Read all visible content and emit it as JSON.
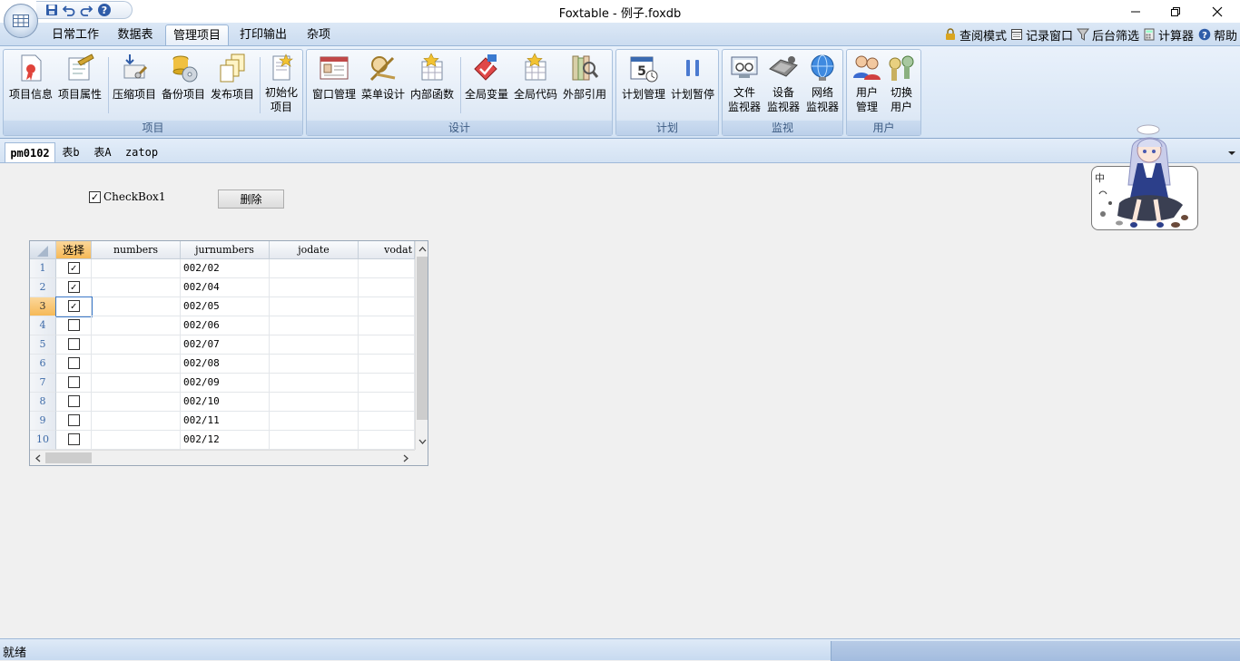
{
  "window": {
    "title": "Foxtable - 例子.foxdb"
  },
  "ribbon_tabs": [
    {
      "label": "日常工作",
      "active": false
    },
    {
      "label": "数据表",
      "active": false
    },
    {
      "label": "管理项目",
      "active": true
    },
    {
      "label": "打印输出",
      "active": false
    },
    {
      "label": "杂项",
      "active": false
    }
  ],
  "right_tools": [
    {
      "label": "查阅模式",
      "icon": "lock-icon"
    },
    {
      "label": "记录窗口",
      "icon": "window-icon"
    },
    {
      "label": "后台筛选",
      "icon": "filter-icon"
    },
    {
      "label": "计算器",
      "icon": "calculator-icon"
    },
    {
      "label": "帮助",
      "icon": "help-icon"
    }
  ],
  "groups": [
    {
      "label": "项目",
      "buttons": [
        {
          "label": "项目信息",
          "icon": "project-info-icon"
        },
        {
          "label": "项目属性",
          "icon": "project-properties-icon"
        },
        {
          "label": "压缩项目",
          "icon": "compress-project-icon"
        },
        {
          "label": "备份项目",
          "icon": "backup-project-icon"
        },
        {
          "label": "发布项目",
          "icon": "publish-project-icon"
        },
        {
          "label": "初始化\n项目",
          "icon": "initialize-project-icon"
        }
      ]
    },
    {
      "label": "设计",
      "buttons": [
        {
          "label": "窗口管理",
          "icon": "window-manage-icon"
        },
        {
          "label": "菜单设计",
          "icon": "menu-design-icon"
        },
        {
          "label": "内部函数",
          "icon": "internal-function-icon"
        },
        {
          "label": "全局变量",
          "icon": "global-variable-icon"
        },
        {
          "label": "全局代码",
          "icon": "global-code-icon"
        },
        {
          "label": "外部引用",
          "icon": "external-reference-icon"
        }
      ]
    },
    {
      "label": "计划",
      "buttons": [
        {
          "label": "计划管理",
          "icon": "schedule-manage-icon"
        },
        {
          "label": "计划暂停",
          "icon": "pause-icon"
        }
      ]
    },
    {
      "label": "监视",
      "buttons": [
        {
          "label": "文件\n监视器",
          "icon": "file-monitor-icon"
        },
        {
          "label": "设备\n监视器",
          "icon": "device-monitor-icon"
        },
        {
          "label": "网络\n监视器",
          "icon": "network-monitor-icon"
        }
      ]
    },
    {
      "label": "用户",
      "buttons": [
        {
          "label": "用户\n管理",
          "icon": "user-manage-icon"
        },
        {
          "label": "切换\n用户",
          "icon": "switch-user-icon"
        }
      ]
    }
  ],
  "doc_tabs": [
    {
      "label": "pm0102",
      "active": true
    },
    {
      "label": "表b",
      "active": false
    },
    {
      "label": "表A",
      "active": false
    },
    {
      "label": "zatop",
      "active": false
    }
  ],
  "form": {
    "checkbox_label": "CheckBox1",
    "checkbox_checked": true,
    "delete_label": "删除"
  },
  "grid": {
    "columns": [
      "选择",
      "numbers",
      "jurnumbers",
      "jodate",
      "vodat"
    ],
    "rows": [
      {
        "n": "1",
        "checked": true,
        "numbers": "",
        "jurnumbers": "002/02",
        "jodate": "",
        "vodat": ""
      },
      {
        "n": "2",
        "checked": true,
        "numbers": "",
        "jurnumbers": "002/04",
        "jodate": "",
        "vodat": ""
      },
      {
        "n": "3",
        "checked": true,
        "numbers": "",
        "jurnumbers": "002/05",
        "jodate": "",
        "vodat": ""
      },
      {
        "n": "4",
        "checked": false,
        "numbers": "",
        "jurnumbers": "002/06",
        "jodate": "",
        "vodat": ""
      },
      {
        "n": "5",
        "checked": false,
        "numbers": "",
        "jurnumbers": "002/07",
        "jodate": "",
        "vodat": ""
      },
      {
        "n": "6",
        "checked": false,
        "numbers": "",
        "jurnumbers": "002/08",
        "jodate": "",
        "vodat": ""
      },
      {
        "n": "7",
        "checked": false,
        "numbers": "",
        "jurnumbers": "002/09",
        "jodate": "",
        "vodat": ""
      },
      {
        "n": "8",
        "checked": false,
        "numbers": "",
        "jurnumbers": "002/10",
        "jodate": "",
        "vodat": ""
      },
      {
        "n": "9",
        "checked": false,
        "numbers": "",
        "jurnumbers": "002/11",
        "jodate": "",
        "vodat": ""
      },
      {
        "n": "10",
        "checked": false,
        "numbers": "",
        "jurnumbers": "002/12",
        "jodate": "",
        "vodat": ""
      }
    ]
  },
  "mascot": {
    "badge": "中"
  },
  "status": {
    "text": "就绪"
  }
}
